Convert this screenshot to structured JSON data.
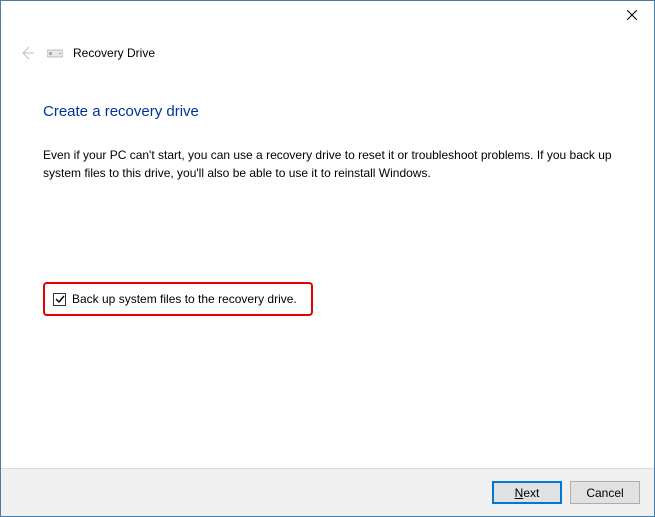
{
  "titlebar": {
    "close_label": "Close"
  },
  "header": {
    "title": "Recovery Drive"
  },
  "content": {
    "heading": "Create a recovery drive",
    "description": "Even if your PC can't start, you can use a recovery drive to reset it or troubleshoot problems. If you back up system files to this drive, you'll also be able to use it to reinstall Windows.",
    "checkbox_label": "Back up system files to the recovery drive.",
    "checkbox_checked": true
  },
  "footer": {
    "next_label": "Next",
    "next_accesskey": "N",
    "cancel_label": "Cancel"
  }
}
